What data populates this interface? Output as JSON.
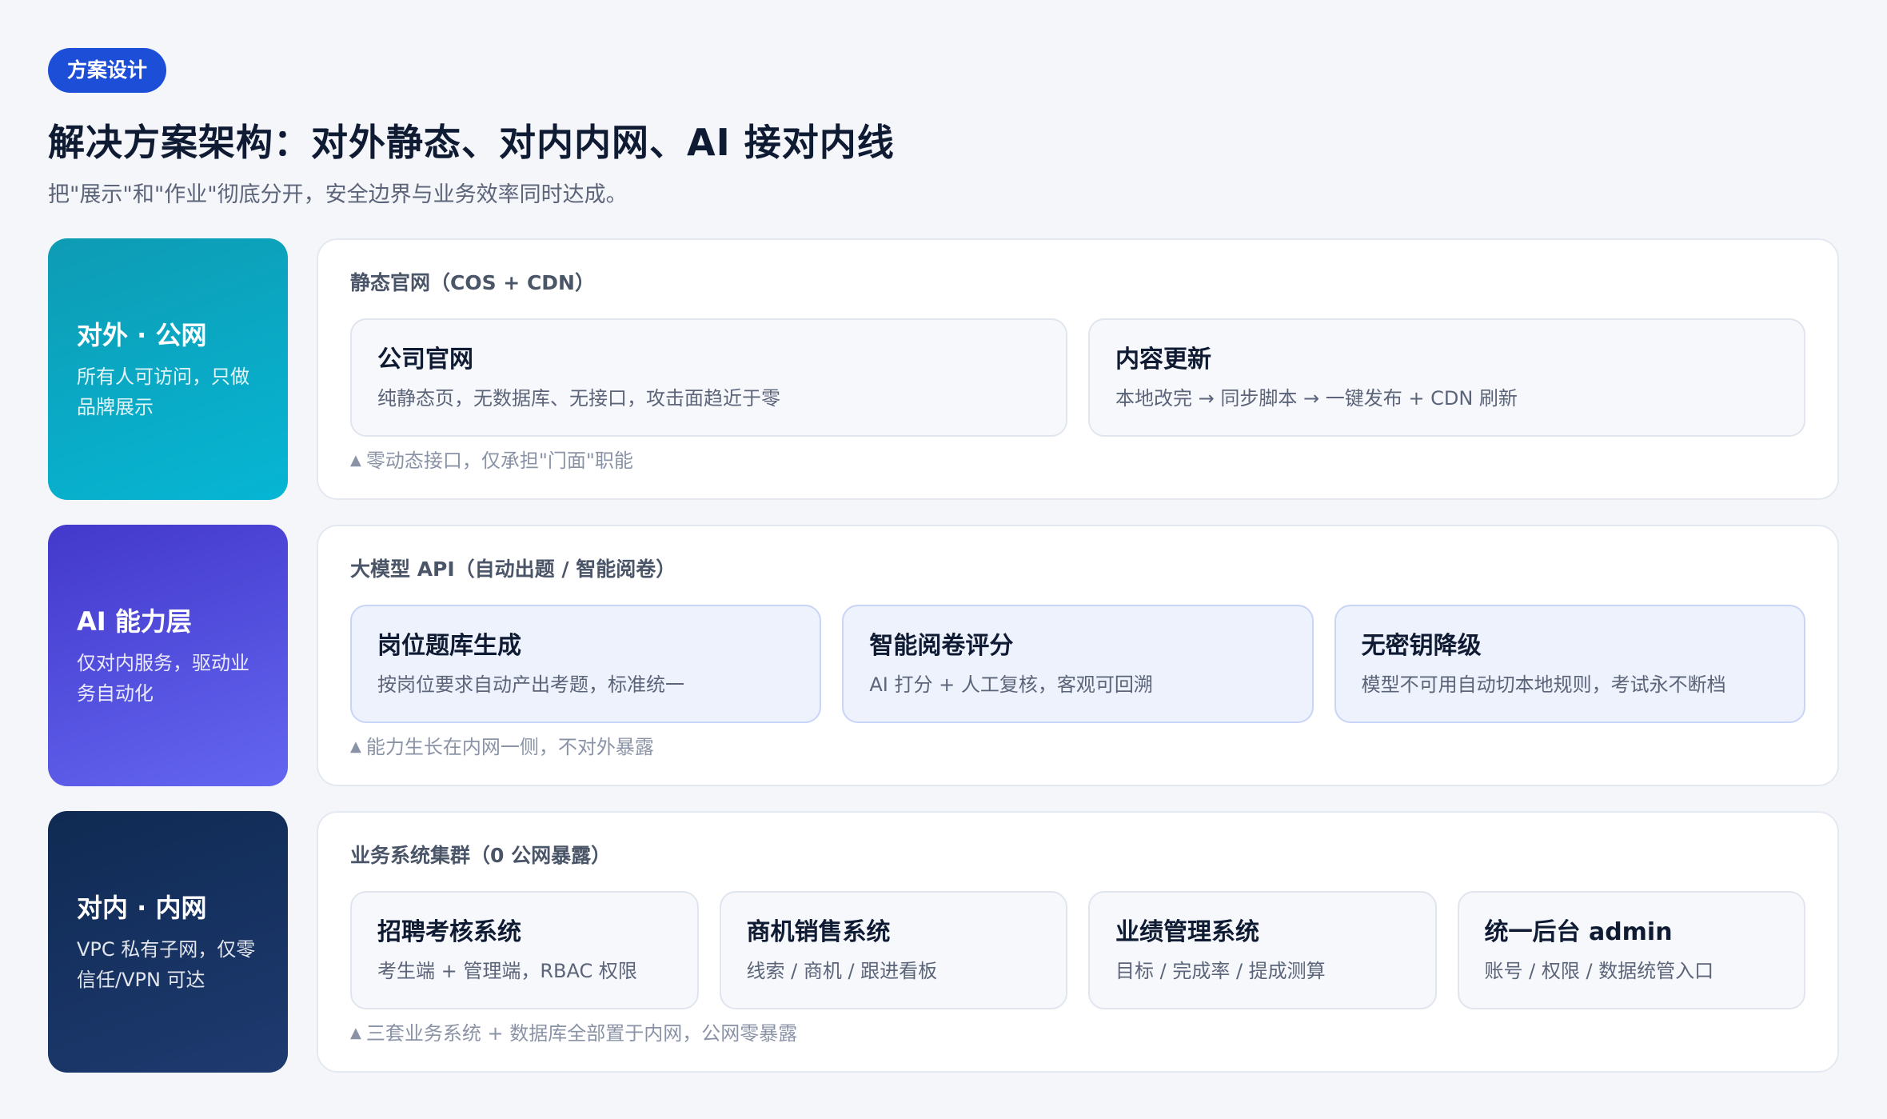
{
  "header": {
    "badge": "方案设计",
    "title": "解决方案架构：对外静态、对内内网、AI 接对内线",
    "subtitle": "把\"展示\"和\"作业\"彻底分开，安全边界与业务效率同时达成。"
  },
  "layers": [
    {
      "side_title": "对外 · 公网",
      "side_desc": "所有人可访问，只做品牌展示",
      "panel_label": "静态官网（COS + CDN）",
      "cards": [
        {
          "title": "公司官网",
          "desc": "纯静态页，无数据库、无接口，攻击面趋近于零"
        },
        {
          "title": "内容更新",
          "desc": "本地改完 → 同步脚本 → 一键发布 + CDN 刷新"
        }
      ],
      "note": "零动态接口，仅承担\"门面\"职能"
    },
    {
      "side_title": "AI 能力层",
      "side_desc": "仅对内服务，驱动业务自动化",
      "panel_label": "大模型 API（自动出题 / 智能阅卷）",
      "cards": [
        {
          "title": "岗位题库生成",
          "desc": "按岗位要求自动产出考题，标准统一"
        },
        {
          "title": "智能阅卷评分",
          "desc": "AI 打分 + 人工复核，客观可回溯"
        },
        {
          "title": "无密钥降级",
          "desc": "模型不可用自动切本地规则，考试永不断档"
        }
      ],
      "note": "能力生长在内网一侧，不对外暴露"
    },
    {
      "side_title": "对内 · 内网",
      "side_desc": "VPC 私有子网，仅零信任/VPN 可达",
      "panel_label": "业务系统集群（0 公网暴露）",
      "cards": [
        {
          "title": "招聘考核系统",
          "desc": "考生端 + 管理端，RBAC 权限"
        },
        {
          "title": "商机销售系统",
          "desc": "线索 / 商机 / 跟进看板"
        },
        {
          "title": "业绩管理系统",
          "desc": "目标 / 完成率 / 提成测算"
        },
        {
          "title": "统一后台 admin",
          "desc": "账号 / 权限 / 数据统管入口"
        }
      ],
      "note": "三套业务系统 + 数据库全部置于内网，公网零暴露"
    }
  ],
  "colors": {
    "badge": "#1d4ed8",
    "public_layer": "#06b6d4",
    "ai_layer": "#4f46e5",
    "internal_layer": "#0f2a52"
  },
  "icons": {
    "note_marker": "triangle-up-icon"
  }
}
